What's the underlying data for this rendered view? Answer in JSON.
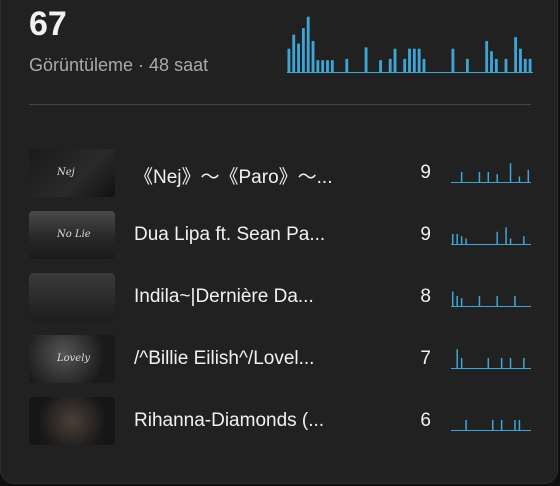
{
  "summary": {
    "count": "67",
    "subtitle": "Görüntüleme · 48 saat",
    "accent_color": "#3ea6d6",
    "hourly_bars": [
      0.38,
      0.6,
      0.46,
      0.7,
      0.88,
      0.5,
      0.2,
      0.2,
      0.2,
      0.2,
      0,
      0,
      0.22,
      0,
      0,
      0,
      0.4,
      0,
      0,
      0.2,
      0,
      0.22,
      0.38,
      0,
      0.22,
      0.38,
      0.38,
      0.38,
      0.22,
      0,
      0,
      0,
      0,
      0,
      0.38,
      0,
      0,
      0.22,
      0,
      0,
      0,
      0.5,
      0.34,
      0.22,
      0,
      0.22,
      0,
      0.56,
      0.38,
      0.22,
      0.22
    ]
  },
  "videos": [
    {
      "title": "《Nej》～《Paro》～...",
      "views": "9",
      "thumb_text": "Nej",
      "spark": [
        0,
        0,
        0.5,
        0,
        0,
        0,
        0.5,
        0,
        0.5,
        0,
        0.4,
        0,
        0,
        0.9,
        0,
        0.3,
        0,
        0.6
      ]
    },
    {
      "title": "Dua Lipa ft. Sean Pa...",
      "views": "9",
      "thumb_text": "No Lie",
      "spark": [
        0.5,
        0.5,
        0.4,
        0.3,
        0,
        0,
        0,
        0,
        0,
        0,
        0.6,
        0,
        0.8,
        0.3,
        0,
        0,
        0.4,
        0
      ]
    },
    {
      "title": "Indila~|Dernière Da...",
      "views": "8",
      "thumb_text": "",
      "spark": [
        0.7,
        0.5,
        0.4,
        0,
        0,
        0,
        0.5,
        0,
        0,
        0,
        0.5,
        0,
        0,
        0,
        0.5,
        0,
        0,
        0
      ]
    },
    {
      "title": "/^Billie Eilish^/Lovel...",
      "views": "7",
      "thumb_text": "Lovely",
      "spark": [
        0,
        0.9,
        0.5,
        0,
        0,
        0,
        0,
        0,
        0.5,
        0,
        0,
        0.5,
        0,
        0.5,
        0,
        0,
        0.5,
        0
      ]
    },
    {
      "title": "Rihanna-Diamonds (...",
      "views": "6",
      "thumb_text": "",
      "spark": [
        0,
        0,
        0,
        0.5,
        0,
        0,
        0,
        0,
        0,
        0.5,
        0,
        0.5,
        0,
        0,
        0.5,
        0.5,
        0,
        0
      ]
    }
  ]
}
